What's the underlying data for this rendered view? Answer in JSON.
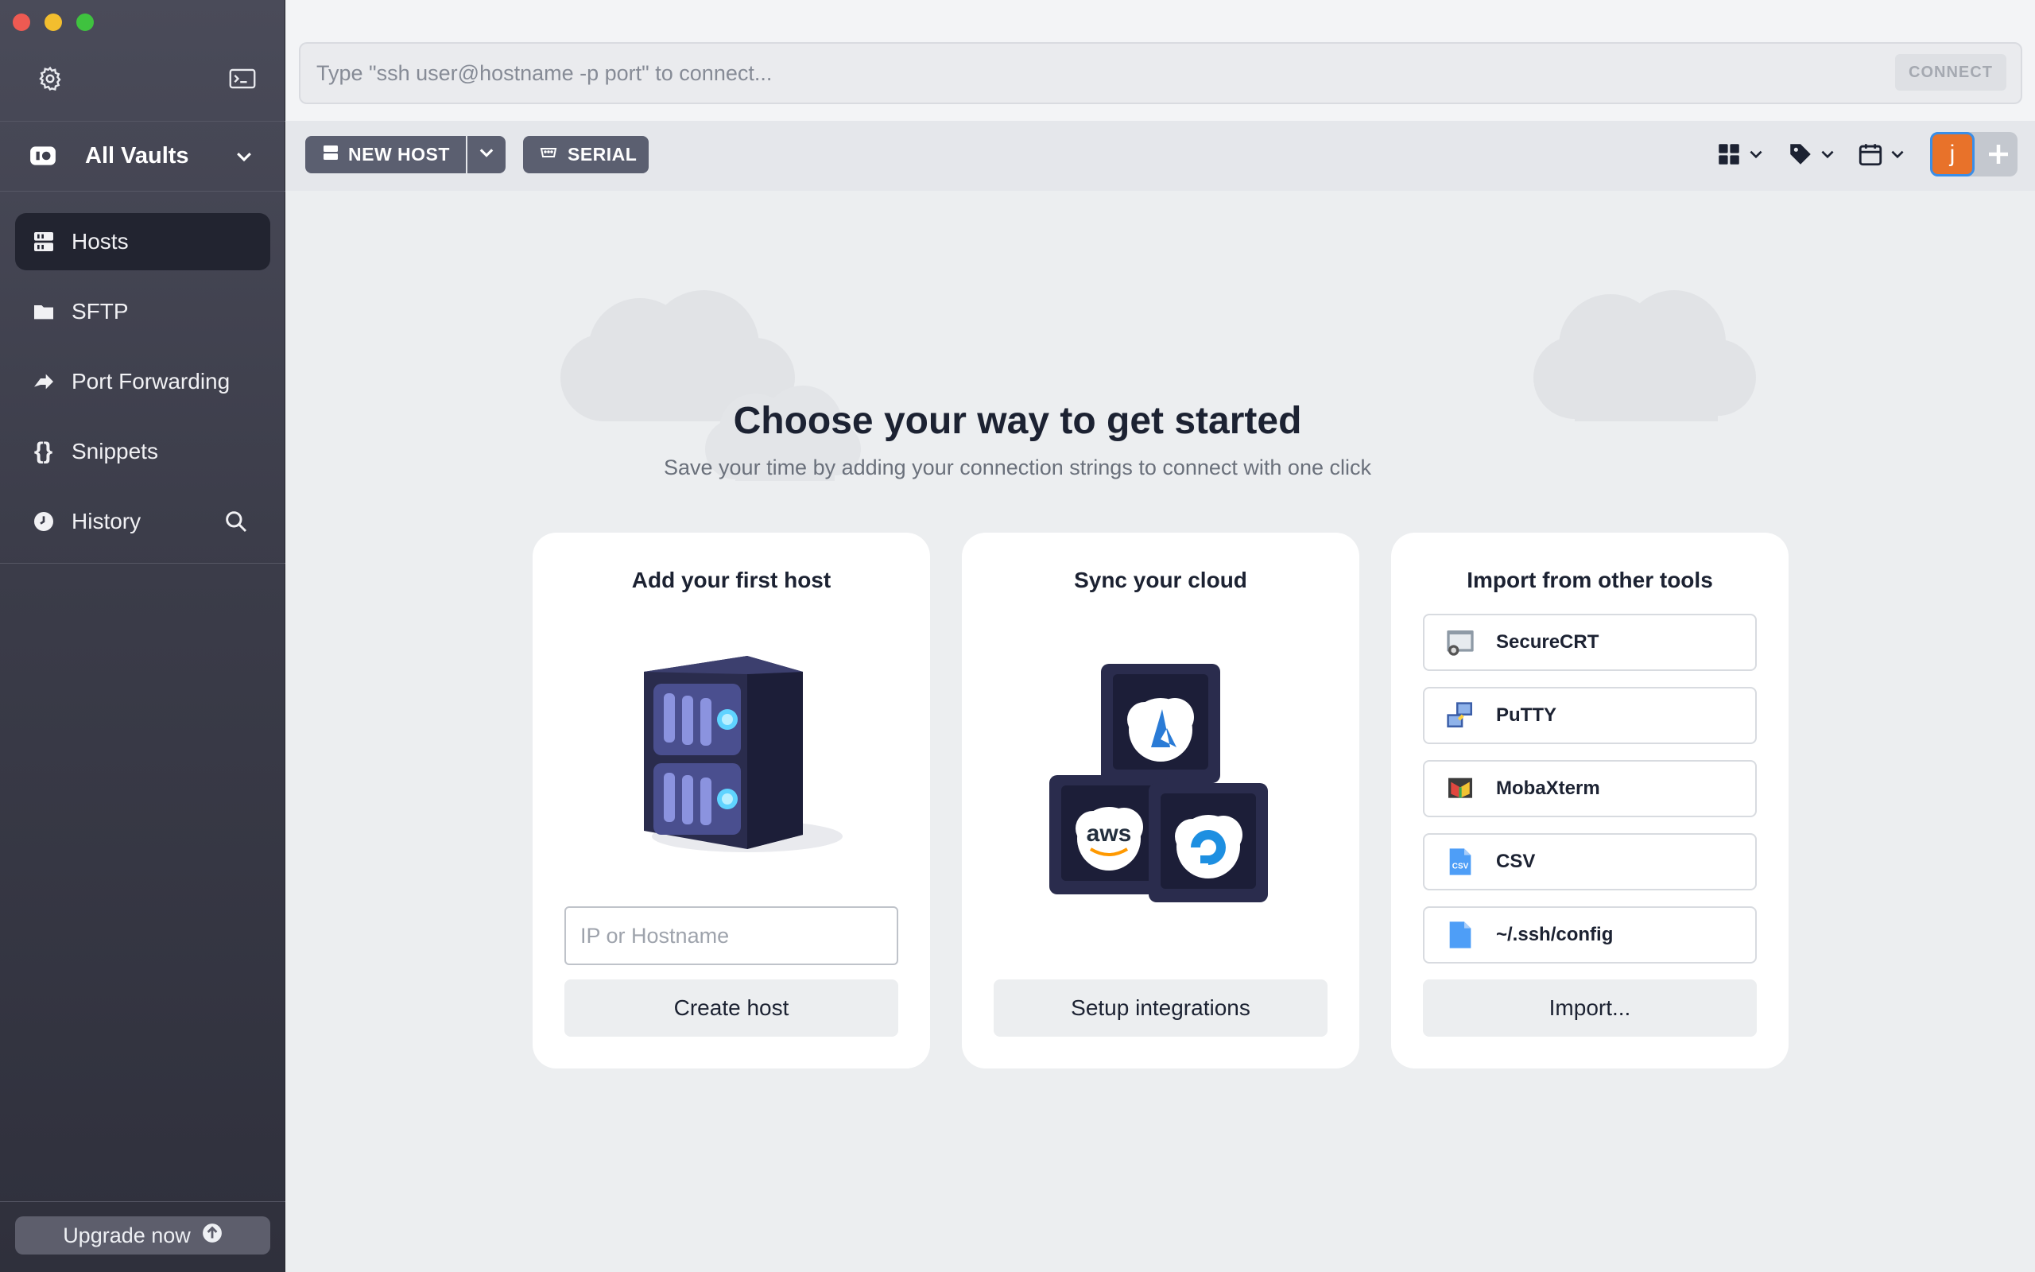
{
  "window": {
    "controls": [
      "close",
      "minimize",
      "maximize"
    ]
  },
  "sidebar": {
    "settings_icon": "gear-icon",
    "terminal_icon": "terminal-icon",
    "vault": {
      "label": "All Vaults"
    },
    "items": [
      {
        "label": "Hosts",
        "icon": "hosts-icon",
        "active": true
      },
      {
        "label": "SFTP",
        "icon": "folder-icon"
      },
      {
        "label": "Port Forwarding",
        "icon": "port-forward-icon"
      },
      {
        "label": "Snippets",
        "icon": "braces-icon"
      },
      {
        "label": "History",
        "icon": "clock-icon"
      }
    ],
    "upgrade_label": "Upgrade now"
  },
  "command_bar": {
    "placeholder": "Type \"ssh user@hostname -p port\" to connect...",
    "connect_label": "CONNECT"
  },
  "toolbar": {
    "new_host_label": "NEW HOST",
    "serial_label": "SERIAL",
    "avatar_letter": "j"
  },
  "main": {
    "heading": "Choose your way to get started",
    "subheading": "Save your time by adding your connection strings to connect with one click",
    "cards": {
      "host": {
        "title": "Add your first host",
        "input_placeholder": "IP or Hostname",
        "button": "Create host"
      },
      "cloud": {
        "title": "Sync your cloud",
        "button": "Setup integrations"
      },
      "import": {
        "title": "Import from other tools",
        "items": [
          {
            "label": "SecureCRT"
          },
          {
            "label": "PuTTY"
          },
          {
            "label": "MobaXterm"
          },
          {
            "label": "CSV"
          },
          {
            "label": "~/.ssh/config"
          }
        ],
        "button": "Import..."
      }
    }
  },
  "colors": {
    "accent_orange": "#e8722a",
    "sidebar_bg": "#3d3e4b",
    "active_item": "#222430",
    "button_dark": "#5b5f70"
  }
}
